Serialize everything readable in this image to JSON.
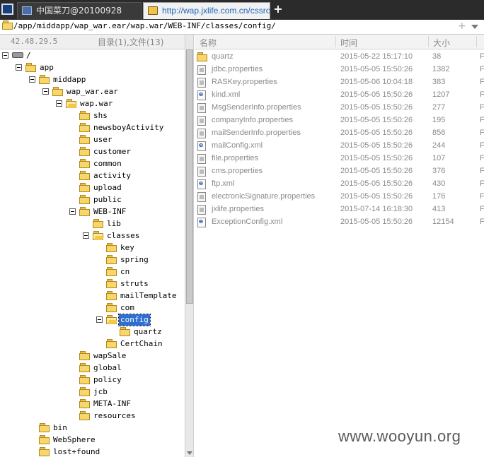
{
  "tabs": [
    {
      "label": "中国菜刀@20100928",
      "active": false
    },
    {
      "label": "http://wap.jxlife.com.cn/cssro...",
      "active": true
    }
  ],
  "new_tab_symbol": "+",
  "path_bar": {
    "path": "/app/middapp/wap_war.ear/wap.war/WEB-INF/classes/config/",
    "plus": "+"
  },
  "left_header": {
    "ip": "42.48.29.5",
    "counts": "目录(1),文件(13)"
  },
  "tree": [
    {
      "label": "/",
      "depth": 0,
      "icon": "drive",
      "expanded": true
    },
    {
      "label": "app",
      "depth": 1,
      "icon": "folder",
      "expanded": true
    },
    {
      "label": "middapp",
      "depth": 2,
      "icon": "folder",
      "expanded": true
    },
    {
      "label": "wap_war.ear",
      "depth": 3,
      "icon": "folder",
      "expanded": true
    },
    {
      "label": "wap.war",
      "depth": 4,
      "icon": "folder-open",
      "expanded": true
    },
    {
      "label": "shs",
      "depth": 5,
      "icon": "folder"
    },
    {
      "label": "newsboyActivity",
      "depth": 5,
      "icon": "folder"
    },
    {
      "label": "user",
      "depth": 5,
      "icon": "folder"
    },
    {
      "label": "customer",
      "depth": 5,
      "icon": "folder"
    },
    {
      "label": "common",
      "depth": 5,
      "icon": "folder"
    },
    {
      "label": "activity",
      "depth": 5,
      "icon": "folder"
    },
    {
      "label": "upload",
      "depth": 5,
      "icon": "folder"
    },
    {
      "label": "public",
      "depth": 5,
      "icon": "folder"
    },
    {
      "label": "WEB-INF",
      "depth": 5,
      "icon": "folder",
      "expanded": true
    },
    {
      "label": "lib",
      "depth": 6,
      "icon": "folder"
    },
    {
      "label": "classes",
      "depth": 6,
      "icon": "folder-open",
      "expanded": true
    },
    {
      "label": "key",
      "depth": 7,
      "icon": "folder"
    },
    {
      "label": "spring",
      "depth": 7,
      "icon": "folder"
    },
    {
      "label": "cn",
      "depth": 7,
      "icon": "folder"
    },
    {
      "label": "struts",
      "depth": 7,
      "icon": "folder"
    },
    {
      "label": "mailTemplate",
      "depth": 7,
      "icon": "folder"
    },
    {
      "label": "com",
      "depth": 7,
      "icon": "folder"
    },
    {
      "label": "config",
      "depth": 7,
      "icon": "folder-open",
      "expanded": true,
      "selected": true
    },
    {
      "label": "quartz",
      "depth": 8,
      "icon": "folder"
    },
    {
      "label": "CertChain",
      "depth": 7,
      "icon": "folder"
    },
    {
      "label": "wapSale",
      "depth": 5,
      "icon": "folder"
    },
    {
      "label": "global",
      "depth": 5,
      "icon": "folder"
    },
    {
      "label": "policy",
      "depth": 5,
      "icon": "folder"
    },
    {
      "label": "jcb",
      "depth": 5,
      "icon": "folder"
    },
    {
      "label": "META-INF",
      "depth": 5,
      "icon": "folder"
    },
    {
      "label": "resources",
      "depth": 5,
      "icon": "folder"
    },
    {
      "label": "bin",
      "depth": 2,
      "icon": "folder"
    },
    {
      "label": "WebSphere",
      "depth": 2,
      "icon": "folder"
    },
    {
      "label": "lost+found",
      "depth": 2,
      "icon": "folder"
    }
  ],
  "list_header": {
    "name": "名称",
    "time": "时间",
    "size": "大小"
  },
  "files": [
    {
      "name": "quartz",
      "time": "2015-05-22 15:17:10",
      "size": "38",
      "perm": "F",
      "type": "folder"
    },
    {
      "name": "jdbc.properties",
      "time": "2015-05-05 15:50:26",
      "size": "1382",
      "perm": "F",
      "type": "prop"
    },
    {
      "name": "RASKey.properties",
      "time": "2015-05-06 10:04:18",
      "size": "383",
      "perm": "F",
      "type": "prop"
    },
    {
      "name": "kind.xml",
      "time": "2015-05-05 15:50:26",
      "size": "1207",
      "perm": "F",
      "type": "xml"
    },
    {
      "name": "MsgSenderInfo.properties",
      "time": "2015-05-05 15:50:26",
      "size": "277",
      "perm": "F",
      "type": "prop"
    },
    {
      "name": "companyInfo.properties",
      "time": "2015-05-05 15:50:26",
      "size": "195",
      "perm": "F",
      "type": "prop"
    },
    {
      "name": "mailSenderInfo.properties",
      "time": "2015-05-05 15:50:26",
      "size": "856",
      "perm": "F",
      "type": "prop"
    },
    {
      "name": "mailConfig.xml",
      "time": "2015-05-05 15:50:26",
      "size": "244",
      "perm": "F",
      "type": "xml"
    },
    {
      "name": "file.properties",
      "time": "2015-05-05 15:50:26",
      "size": "107",
      "perm": "F",
      "type": "prop"
    },
    {
      "name": "cms.properties",
      "time": "2015-05-05 15:50:26",
      "size": "376",
      "perm": "F",
      "type": "prop"
    },
    {
      "name": "ftp.xml",
      "time": "2015-05-05 15:50:26",
      "size": "430",
      "perm": "F",
      "type": "xml"
    },
    {
      "name": "electronicSignature.properties",
      "time": "2015-05-05 15:50:26",
      "size": "176",
      "perm": "F",
      "type": "prop"
    },
    {
      "name": "jxlife.properties",
      "time": "2015-07-14 16:18:30",
      "size": "413",
      "perm": "F",
      "type": "prop"
    },
    {
      "name": "ExceptionConfig.xml",
      "time": "2015-05-05 15:50:26",
      "size": "12154",
      "perm": "F",
      "type": "xml"
    }
  ],
  "watermark": "www.wooyun.org"
}
